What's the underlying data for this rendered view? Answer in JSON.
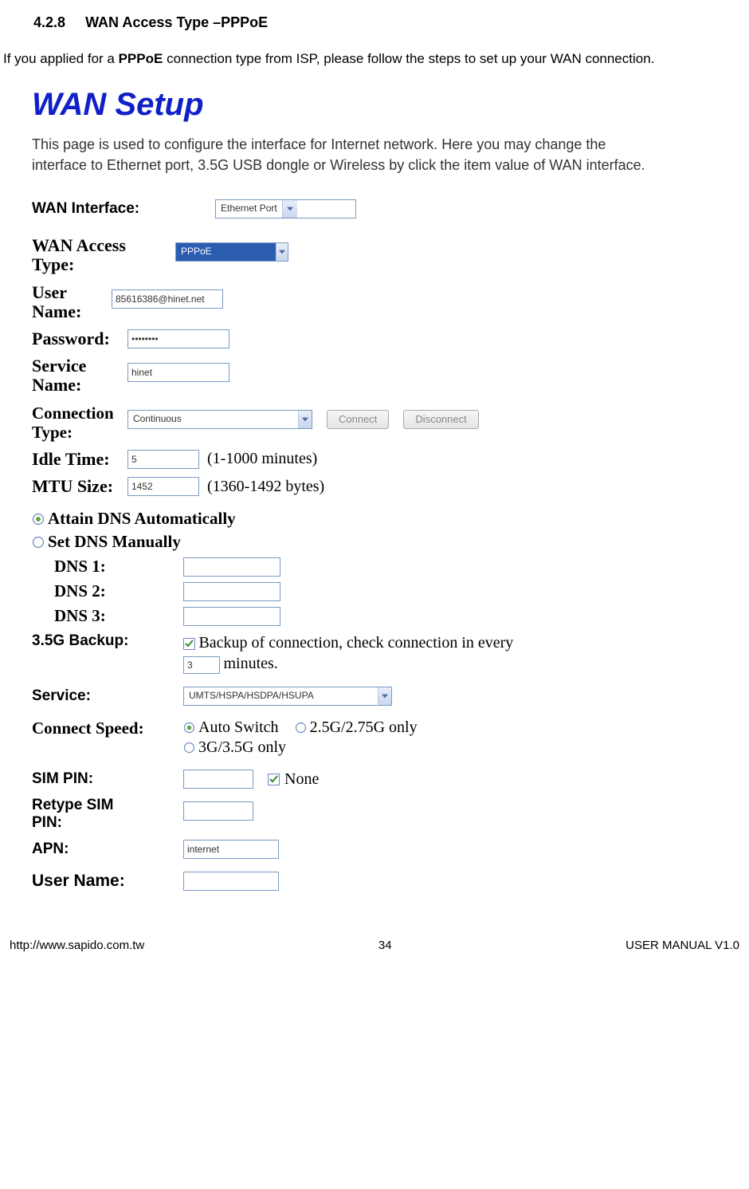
{
  "section_number": "4.2.8",
  "section_title": "WAN Access Type –PPPoE",
  "intro_pre": "If you applied for a ",
  "intro_bold": "PPPoE",
  "intro_post": " connection type from ISP, please follow the steps to set up your WAN connection.",
  "wan_setup": {
    "title": "WAN Setup",
    "description": "This page is used to configure the interface for Internet network. Here you may change the interface to Ethernet port, 3.5G USB dongle or Wireless by click the item value of WAN interface.",
    "wan_interface_label": "WAN Interface:",
    "wan_interface_value": "Ethernet Port",
    "wan_access_type_label": "WAN Access Type:",
    "wan_access_type_value": "PPPoE",
    "user_name_label": "User Name:",
    "user_name_value": "85616386@hinet.net",
    "password_label": "Password:",
    "password_value": "••••••••",
    "service_name_label": "Service Name:",
    "service_name_value": "hinet",
    "connection_type_label": "Connection Type:",
    "connection_type_value": "Continuous",
    "connect_btn": "Connect",
    "disconnect_btn": "Disconnect",
    "idle_time_label": "Idle Time:",
    "idle_time_value": "5",
    "idle_time_hint": "(1-1000 minutes)",
    "mtu_size_label": "MTU Size:",
    "mtu_size_value": "1452",
    "mtu_size_hint": "(1360-1492 bytes)",
    "dns_auto_label": "Attain DNS Automatically",
    "dns_manual_label": "Set DNS Manually",
    "dns1_label": "DNS 1:",
    "dns2_label": "DNS 2:",
    "dns3_label": "DNS 3:",
    "backup_label": "3.5G Backup:",
    "backup_text_pre": "Backup of connection, check connection in every ",
    "backup_minutes_value": "3",
    "backup_text_post": " minutes.",
    "service_label": "Service:",
    "service_value": "UMTS/HSPA/HSDPA/HSUPA",
    "connect_speed_label": "Connect Speed:",
    "speed_auto": "Auto Switch",
    "speed_25g": "2.5G/2.75G only",
    "speed_3g": "3G/3.5G only",
    "sim_pin_label": "SIM PIN:",
    "sim_none": "None",
    "retype_sim_label": "Retype SIM PIN:",
    "apn_label": "APN:",
    "apn_value": "internet",
    "user_name2_label": "User Name:"
  },
  "footer": {
    "left": "http://www.sapido.com.tw",
    "center": "34",
    "right": "USER MANUAL V1.0"
  }
}
